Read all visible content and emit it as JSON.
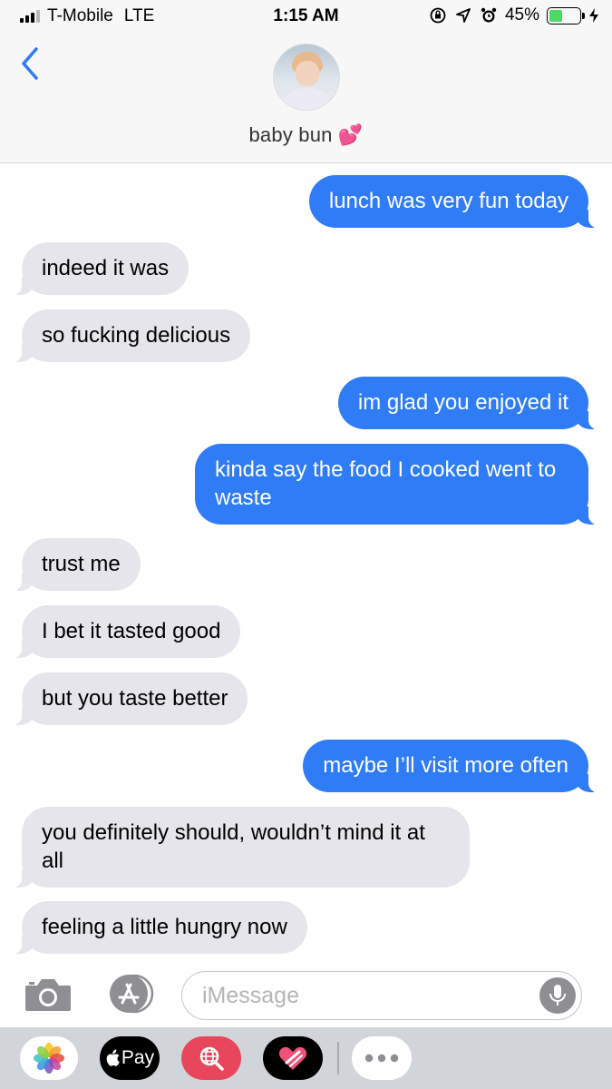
{
  "status_bar": {
    "carrier": "T-Mobile",
    "network": "LTE",
    "time": "1:15 AM",
    "battery_percent": "45%",
    "battery_level": 0.45,
    "icons": [
      "signal-icon",
      "lock-rotation-icon",
      "location-icon",
      "alarm-icon",
      "battery-icon",
      "charging-icon"
    ]
  },
  "header": {
    "contact_name": "baby bun 💕",
    "back_icon": "chevron-left-icon"
  },
  "messages": [
    {
      "dir": "sent",
      "text": "lunch was very fun today"
    },
    {
      "dir": "recv",
      "text": "indeed it was"
    },
    {
      "dir": "recv",
      "text": "so fucking delicious"
    },
    {
      "dir": "sent",
      "text": "im glad you enjoyed it"
    },
    {
      "dir": "sent",
      "text": "kinda say the food I cooked went to waste"
    },
    {
      "dir": "recv",
      "text": "trust me"
    },
    {
      "dir": "recv",
      "text": "I bet it tasted good"
    },
    {
      "dir": "recv",
      "text": "but you taste better"
    },
    {
      "dir": "sent",
      "text": "maybe I’ll visit more often"
    },
    {
      "dir": "recv",
      "text": "you definitely should, wouldn’t mind it at all"
    },
    {
      "dir": "recv",
      "text": "feeling a little hungry now"
    }
  ],
  "input_bar": {
    "placeholder": "iMessage"
  },
  "app_drawer": {
    "apple_pay_label": "Pay"
  },
  "colors": {
    "sent_bubble": "#2f7cf6",
    "received_bubble": "#e6e5eb",
    "accent": "#2f7cf6"
  }
}
